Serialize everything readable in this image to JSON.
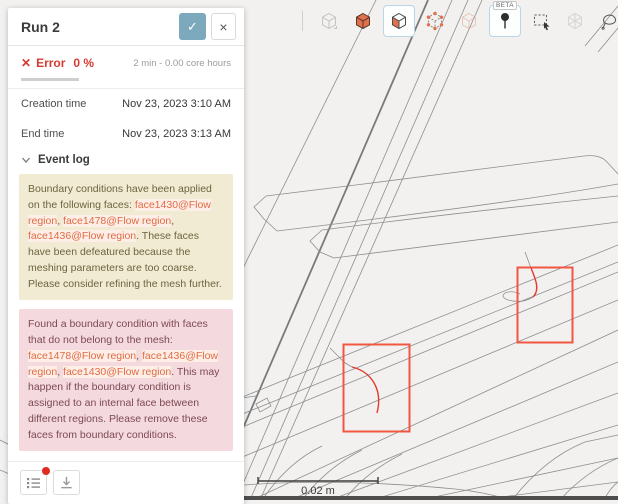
{
  "panel": {
    "title": "Run 2",
    "header_icons": {
      "confirm": "✓",
      "close": "×"
    },
    "status": {
      "error_icon": "✕",
      "error_label": "Error",
      "error_percent": "0 %",
      "usage": "2 min - 0.00 core hours"
    },
    "fields": [
      {
        "label": "Creation time",
        "value": "Nov 23, 2023 3:10 AM"
      },
      {
        "label": "End time",
        "value": "Nov 23, 2023 3:13 AM"
      }
    ],
    "event_log": {
      "header": "Event log",
      "warning": {
        "t1": "Boundary conditions have been applied on the following faces: ",
        "l1": "face1430@Flow region",
        "s1": ", ",
        "l2": "face1478@Flow region",
        "s2": ", ",
        "l3": "face1436@Flow region",
        "t2": ". These faces have been defeatured because the meshing parameters are too coarse. Please consider refining the mesh further."
      },
      "error": {
        "t1": "Found a boundary condition with faces that do not belong to the mesh: ",
        "l1": "face1478@Flow region",
        "s1": ", ",
        "l2": "face1436@Flow region",
        "s2": ", ",
        "l3": "face1430@Flow region",
        "t2": ". This may happen if the boundary condition is assigned to an internal face between different regions. Please remove these faces from boundary conditions."
      }
    }
  },
  "toolbar": {
    "beta_label": "BETA",
    "icons": [
      {
        "name": "view-cube-icon",
        "state": "disabled"
      },
      {
        "name": "solid-mesh-cube-icon",
        "state": "normal"
      },
      {
        "name": "surface-cube-icon",
        "state": "selected"
      },
      {
        "name": "vertices-cube-icon",
        "state": "normal"
      },
      {
        "name": "transparent-cube-icon",
        "state": "disabled"
      },
      {
        "name": "probe-point-icon",
        "state": "selected-beta"
      },
      {
        "name": "box-select-icon",
        "state": "normal"
      },
      {
        "name": "mesh-clip-icon",
        "state": "disabled"
      },
      {
        "name": "lasso-select-icon",
        "state": "normal"
      }
    ]
  },
  "viewport": {
    "scale_label": "0.02 m"
  },
  "colors": {
    "accent_blue": "#7da9bd",
    "error_red": "#d53a32",
    "highlight_box_red": "#f15642",
    "link_orange": "#e06c43",
    "warning_bg": "#f0ebd2",
    "error_bg": "#f4d9de"
  }
}
